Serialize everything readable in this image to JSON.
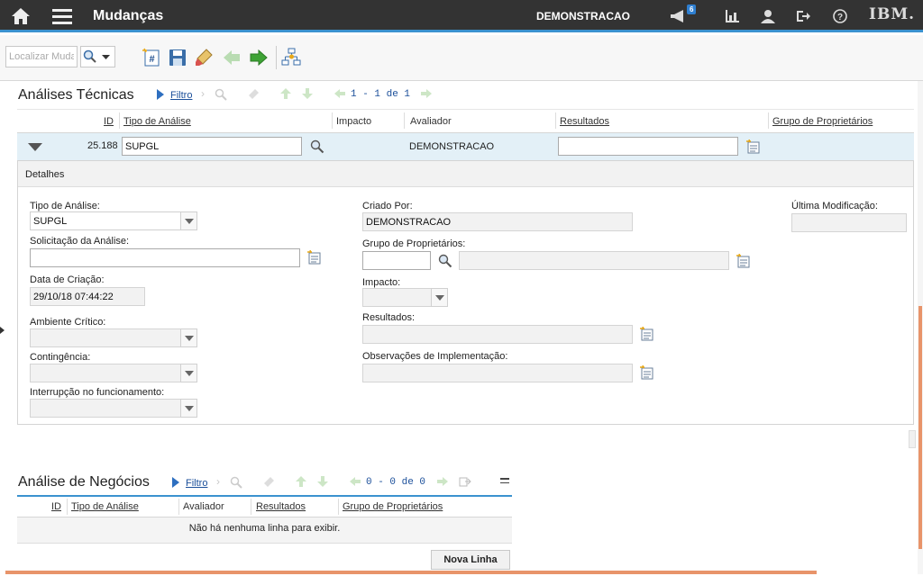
{
  "header": {
    "app_title": "Mudanças",
    "user": "DEMONSTRACAO",
    "notification_count": "6",
    "logo_text": "IBM.",
    "icons": [
      "home-icon",
      "menu-icon",
      "megaphone-icon",
      "report-icon",
      "user-icon",
      "logout-icon",
      "help-icon"
    ]
  },
  "toolbar": {
    "search_placeholder": "Localizar Muda",
    "icons": [
      "search-icon",
      "new-record-icon",
      "save-icon",
      "clear-icon",
      "previous-icon",
      "next-icon",
      "workflow-icon"
    ]
  },
  "technical": {
    "title": "Análises Técnicas",
    "filter": "Filtro",
    "pager": "1 - 1 de 1",
    "columns": {
      "id": "ID",
      "type": "Tipo de Análise",
      "impact": "Impacto",
      "evaluator": "Avaliador",
      "results": "Resultados",
      "owner_group": "Grupo de Proprietários"
    },
    "row": {
      "id": "25.188",
      "type": "SUPGL",
      "impact": "",
      "evaluator": "DEMONSTRACAO",
      "results": ""
    },
    "details": {
      "title": "Detalhes",
      "type_label": "Tipo de Análise:",
      "type_value": "SUPGL",
      "request_label": "Solicitação da Análise:",
      "request_value": "",
      "created_date_label": "Data de Criação:",
      "created_date_value": "29/10/18 07:44:22",
      "critical_env_label": "Ambiente Crítico:",
      "critical_env_value": "",
      "contingency_label": "Contingência:",
      "contingency_value": "",
      "interruption_label": "Interrupção no funcionamento:",
      "interruption_value": "",
      "created_by_label": "Criado Por:",
      "created_by_value": "DEMONSTRACAO",
      "owner_group_label": "Grupo de Proprietários:",
      "owner_group_value": "",
      "impact_label": "Impacto:",
      "impact_value": "",
      "results_label": "Resultados:",
      "results_value": "",
      "impl_notes_label": "Observações de Implementação:",
      "impl_notes_value": "",
      "last_modified_label": "Última Modificação:",
      "last_modified_value": ""
    }
  },
  "business": {
    "title": "Análise de Negócios",
    "filter": "Filtro",
    "pager": "0 - 0 de 0",
    "columns": {
      "id": "ID",
      "type": "Tipo de Análise",
      "evaluator": "Avaliador",
      "results": "Resultados",
      "owner_group": "Grupo de Proprietários"
    },
    "empty_message": "Não há nenhuma linha para exibir.",
    "new_row_button": "Nova Linha"
  }
}
